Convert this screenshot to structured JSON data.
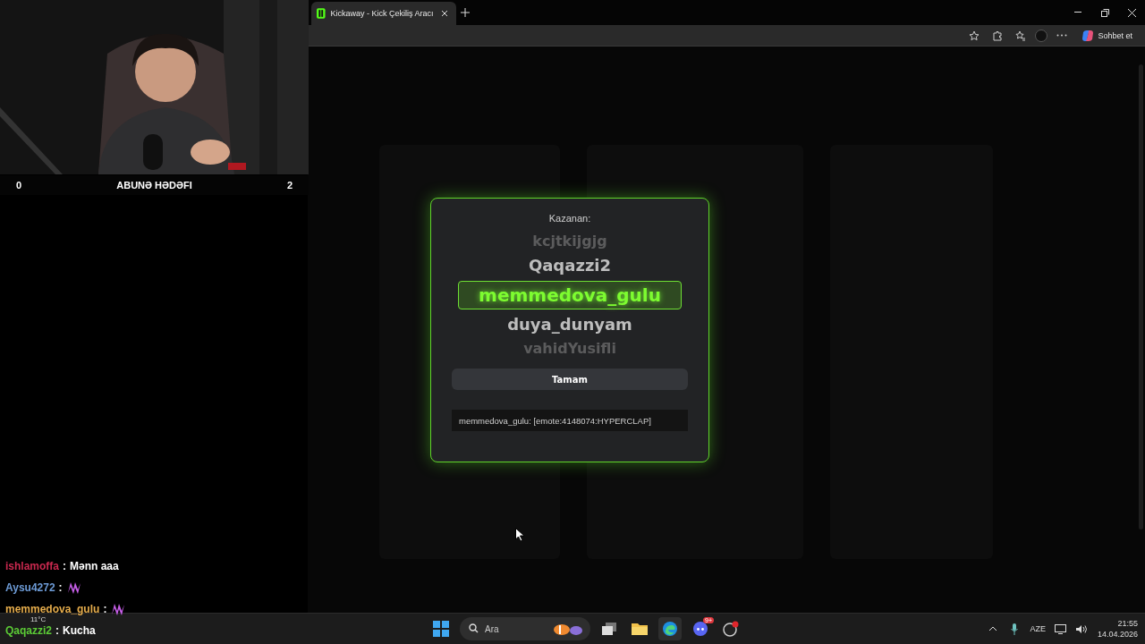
{
  "browser": {
    "tab": {
      "title": "Kickaway - Kick Çekiliş Aracı"
    },
    "copilot_button": "Sohbet et"
  },
  "modal": {
    "heading": "Kazanan:",
    "names": [
      {
        "text": "kcjtkijgjg",
        "kind": "edge",
        "selected": false
      },
      {
        "text": "Qaqazzi2",
        "kind": "near",
        "selected": false
      },
      {
        "text": "memmedova_gulu",
        "kind": "near",
        "selected": true
      },
      {
        "text": "duya_dunyam",
        "kind": "near",
        "selected": false
      },
      {
        "text": "vahidYusifli",
        "kind": "edge",
        "selected": false
      }
    ],
    "ok_button": "Tamam",
    "message": "memmedova_gulu: [emote:4148074:HYPERCLAP]"
  },
  "goal_bar": {
    "current": "0",
    "label": "ABUNƏ HƏDƏFI",
    "target": "2"
  },
  "chat": [
    {
      "user": "ishlamoffa",
      "color": "#c8284e",
      "separator": ":",
      "kind": "text",
      "text": "Mənn aaa"
    },
    {
      "user": "Aysu4272",
      "color": "#6d9bd6",
      "separator": ":",
      "kind": "emote"
    },
    {
      "user": "memmedova_gulu",
      "color": "#e6ad4c",
      "separator": ":",
      "kind": "emote"
    },
    {
      "user": "Qaqazzi2",
      "color": "#5ccc36",
      "separator": ":",
      "kind": "text",
      "text": "Kucha"
    }
  ],
  "taskbar": {
    "search_placeholder": "Ara",
    "weather": "11°C",
    "discord_badge": "9+",
    "language": "AZE",
    "time": "21:55",
    "date": "14.04.2026"
  }
}
